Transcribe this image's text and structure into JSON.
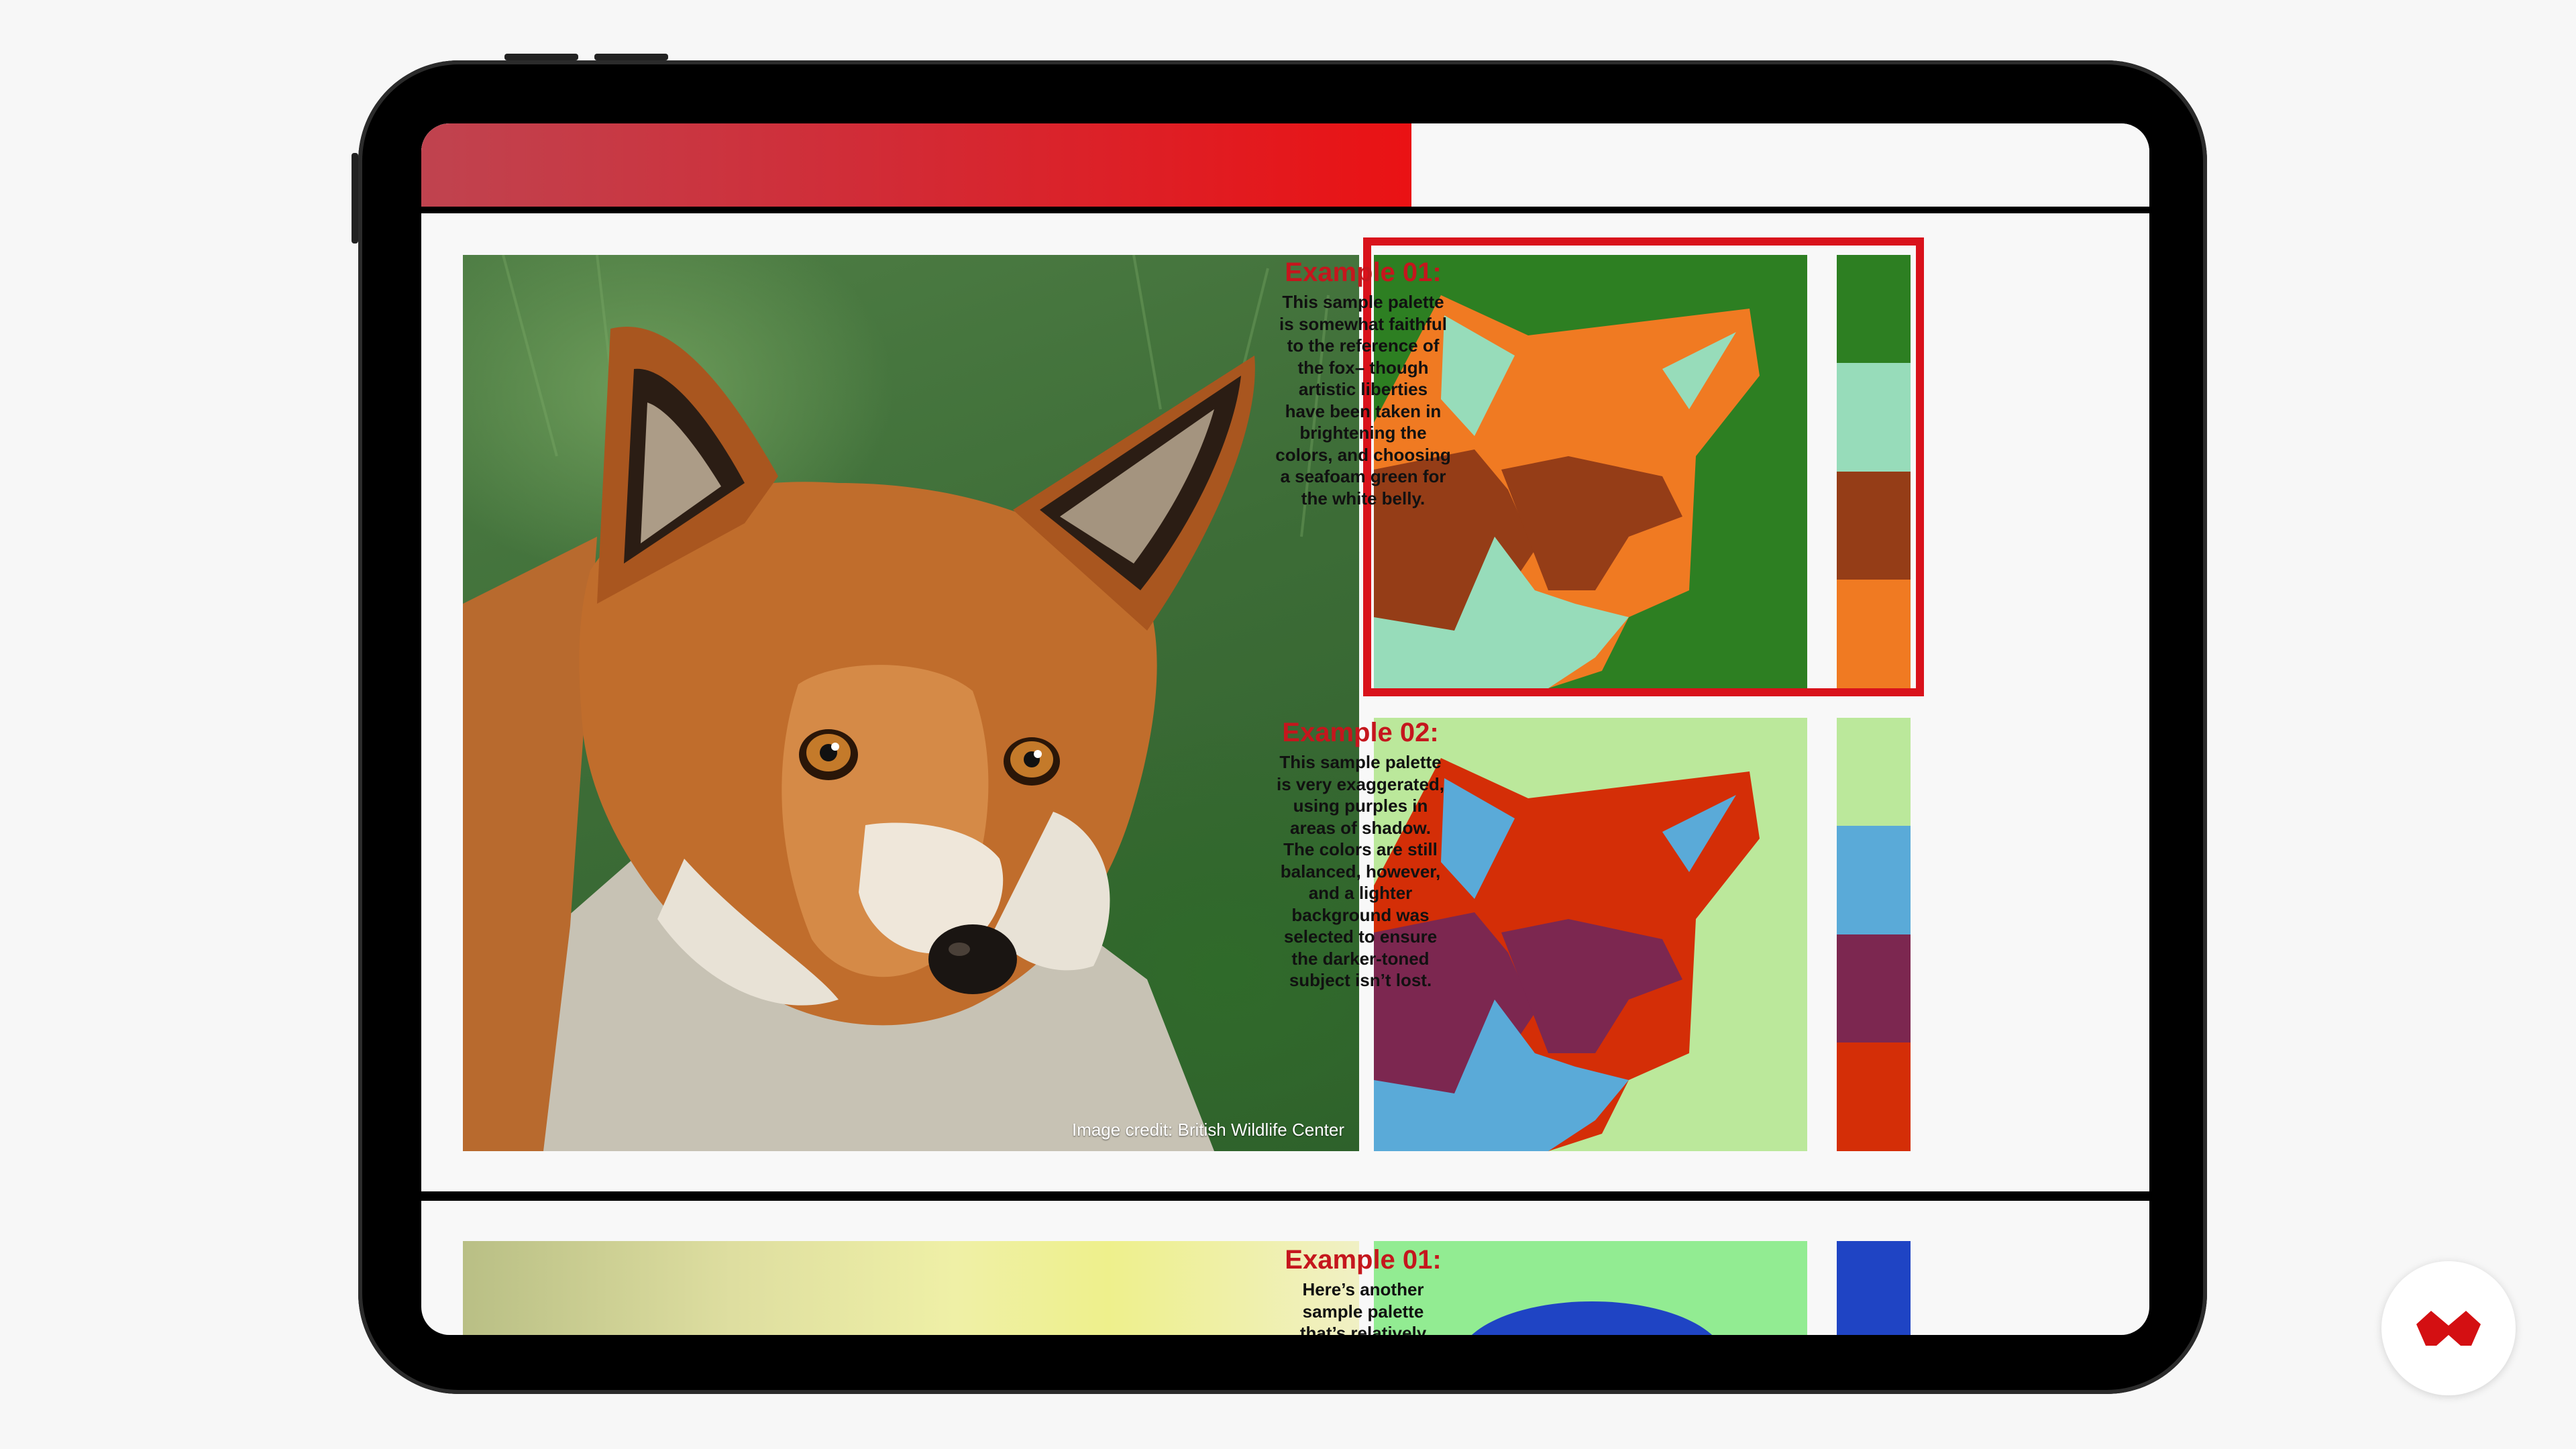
{
  "progress": {
    "fraction": 0.573,
    "colors": {
      "start": "#c0434f",
      "end": "#ea1214"
    }
  },
  "fox_photo": {
    "alt": "Photograph of a red fox head against green foliage",
    "credit": "Image credit: British Wildlife Center"
  },
  "examples": [
    {
      "title": "Example 01:",
      "body": "This sample palette is somewhat faithful to the reference of the fox– though artistic liberties have been taken in brightening the colors, and choosing a seafoam green for the white belly.",
      "body_lines": [
        "This sample palette",
        "is somewhat faithful",
        "to the reference of",
        "the fox– though",
        "artistic liberties",
        "have been taken in",
        "brightening the",
        "colors, and choosing",
        "a seafoam green for",
        "the white belly."
      ],
      "selected": true,
      "palette": {
        "background": "#2d7f22",
        "primary": "#f07a22",
        "secondary": "#953d17",
        "highlight": "#97dcba"
      },
      "swatches": [
        "#2d7f22",
        "#97dcba",
        "#953d17",
        "#f07a22"
      ]
    },
    {
      "title": "Example 02:",
      "body": "This sample palette is very exaggerated, using purples in areas of shadow. The colors are still balanced, however, and a lighter background was selected to ensure the darker-toned subject isn’t lost.",
      "body_lines": [
        "This sample palette",
        "is very exaggerated,",
        "using purples in",
        "areas of shadow.",
        "The colors are still",
        "balanced, however,",
        "and a lighter",
        "background was",
        "selected to ensure",
        "the darker-toned",
        "subject isn’t lost."
      ],
      "selected": false,
      "palette": {
        "background": "#bbe89b",
        "primary": "#d42e07",
        "secondary": "#7c2750",
        "highlight": "#5aaad8"
      },
      "swatches": [
        "#bbe89b",
        "#5aaad8",
        "#7c2750",
        "#d42e07"
      ]
    },
    {
      "title": "Example 01:",
      "body_lines": [
        "Here’s another",
        "sample palette",
        "that’s relatively"
      ],
      "selected": false,
      "palette": {
        "background": "#92ec92",
        "primary": "#1f44c4"
      },
      "swatches": [
        "#1f44c4"
      ]
    }
  ],
  "brand": {
    "icon": "brand-chevron-icon",
    "color": "#d40f12"
  }
}
